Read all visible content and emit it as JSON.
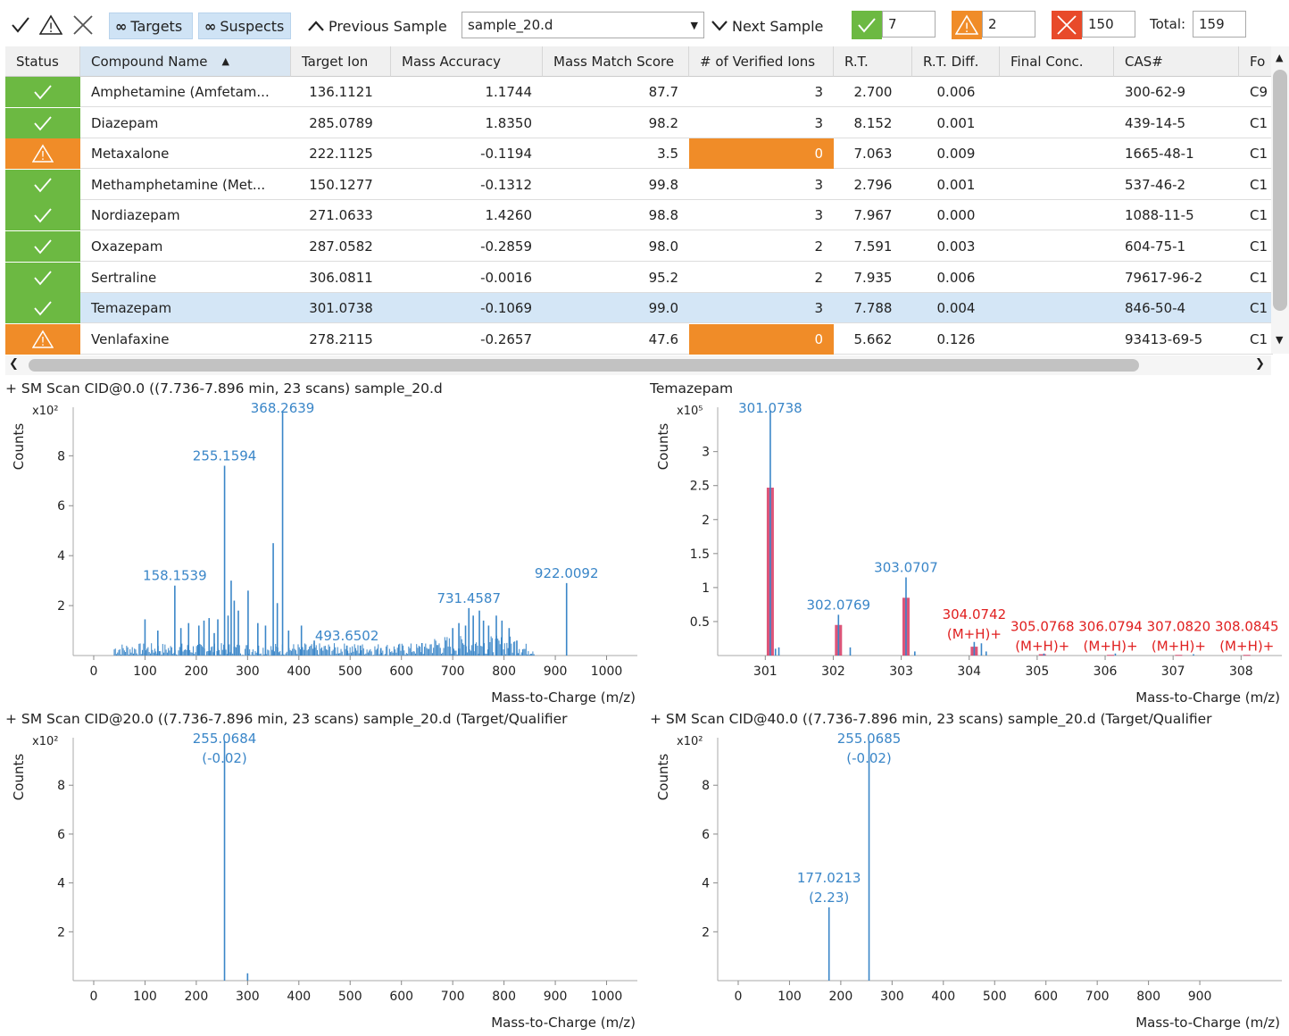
{
  "toolbar": {
    "targets_label": "Targets",
    "suspects_label": "Suspects",
    "previous_label": "Previous Sample",
    "sample_value": "sample_20.d",
    "next_label": "Next Sample",
    "count_ok": "7",
    "count_warn": "2",
    "count_fail": "150",
    "total_label": "Total:",
    "total_value": "159"
  },
  "table": {
    "columns": [
      "Status",
      "Compound Name",
      "Target Ion",
      "Mass Accuracy",
      "Mass Match Score",
      "# of Verified Ions",
      "R.T.",
      "R.T. Diff.",
      "Final Conc.",
      "CAS#",
      "Fo"
    ],
    "rows": [
      {
        "status": "ok",
        "name": "Amphetamine (Amfetam...",
        "ion": "136.1121",
        "acc": "1.1744",
        "score": "87.7",
        "verified": "3",
        "rt": "2.700",
        "rtdiff": "0.006",
        "conc": "",
        "cas": "300-62-9",
        "fo": "C9"
      },
      {
        "status": "ok",
        "name": "Diazepam",
        "ion": "285.0789",
        "acc": "1.8350",
        "score": "98.2",
        "verified": "3",
        "rt": "8.152",
        "rtdiff": "0.001",
        "conc": "",
        "cas": "439-14-5",
        "fo": "C1"
      },
      {
        "status": "warn",
        "name": "Metaxalone",
        "ion": "222.1125",
        "acc": "-0.1194",
        "score": "3.5",
        "verified": "0",
        "rt": "7.063",
        "rtdiff": "0.009",
        "conc": "",
        "cas": "1665-48-1",
        "fo": "C1"
      },
      {
        "status": "ok",
        "name": "Methamphetamine (Met...",
        "ion": "150.1277",
        "acc": "-0.1312",
        "score": "99.8",
        "verified": "3",
        "rt": "2.796",
        "rtdiff": "0.001",
        "conc": "",
        "cas": "537-46-2",
        "fo": "C1"
      },
      {
        "status": "ok",
        "name": "Nordiazepam",
        "ion": "271.0633",
        "acc": "1.4260",
        "score": "98.8",
        "verified": "3",
        "rt": "7.967",
        "rtdiff": "0.000",
        "conc": "",
        "cas": "1088-11-5",
        "fo": "C1"
      },
      {
        "status": "ok",
        "name": "Oxazepam",
        "ion": "287.0582",
        "acc": "-0.2859",
        "score": "98.0",
        "verified": "2",
        "rt": "7.591",
        "rtdiff": "0.003",
        "conc": "",
        "cas": "604-75-1",
        "fo": "C1"
      },
      {
        "status": "ok",
        "name": "Sertraline",
        "ion": "306.0811",
        "acc": "-0.0016",
        "score": "95.2",
        "verified": "2",
        "rt": "7.935",
        "rtdiff": "0.006",
        "conc": "",
        "cas": "79617-96-2",
        "fo": "C1"
      },
      {
        "status": "ok",
        "name": "Temazepam",
        "ion": "301.0738",
        "acc": "-0.1069",
        "score": "99.0",
        "verified": "3",
        "rt": "7.788",
        "rtdiff": "0.004",
        "conc": "",
        "cas": "846-50-4",
        "fo": "C1",
        "selected": true
      },
      {
        "status": "warn",
        "name": "Venlafaxine",
        "ion": "278.2115",
        "acc": "-0.2657",
        "score": "47.6",
        "verified": "0",
        "rt": "5.662",
        "rtdiff": "0.126",
        "conc": "",
        "cas": "93413-69-5",
        "fo": "C1"
      }
    ]
  },
  "colors": {
    "ok": "#6cb942",
    "warn": "#f08c28",
    "fail": "#e84a2a",
    "peak": "#3a86c8",
    "label_blue": "#3a86c8",
    "label_red": "#e02020",
    "iso_bar": "#d9426a"
  },
  "chart_data": [
    {
      "type": "bar",
      "title": "+ SM Scan  CID@0.0 ((7.736-7.896 min, 23 scans) sample_20.d",
      "xlabel": "Mass-to-Charge (m/z)",
      "ylabel": "Counts",
      "y_multiplier": "x10²",
      "xlim": [
        -40,
        1060
      ],
      "ylim": [
        0,
        9.8
      ],
      "xticks": [
        0,
        100,
        200,
        300,
        400,
        500,
        600,
        700,
        800,
        900,
        1000
      ],
      "yticks": [
        2,
        4,
        6,
        8
      ],
      "peaks": [
        {
          "x": 100,
          "y": 1.45
        },
        {
          "x": 125,
          "y": 1.0
        },
        {
          "x": 158.1539,
          "y": 2.8
        },
        {
          "x": 170,
          "y": 1.1
        },
        {
          "x": 185,
          "y": 1.3
        },
        {
          "x": 205,
          "y": 1.2
        },
        {
          "x": 215,
          "y": 1.4
        },
        {
          "x": 225,
          "y": 1.5
        },
        {
          "x": 235,
          "y": 0.9
        },
        {
          "x": 242,
          "y": 1.45
        },
        {
          "x": 255.1594,
          "y": 7.6
        },
        {
          "x": 262,
          "y": 1.6
        },
        {
          "x": 268,
          "y": 3.0
        },
        {
          "x": 274,
          "y": 2.2
        },
        {
          "x": 282,
          "y": 1.8
        },
        {
          "x": 301,
          "y": 2.6
        },
        {
          "x": 320,
          "y": 1.3
        },
        {
          "x": 335,
          "y": 1.2
        },
        {
          "x": 350,
          "y": 4.5
        },
        {
          "x": 358,
          "y": 2.1
        },
        {
          "x": 368.2639,
          "y": 9.8
        },
        {
          "x": 380,
          "y": 1.0
        },
        {
          "x": 405,
          "y": 1.2
        },
        {
          "x": 430,
          "y": 0.6
        },
        {
          "x": 493.6502,
          "y": 0.4
        },
        {
          "x": 520,
          "y": 0.4
        },
        {
          "x": 560,
          "y": 0.3
        },
        {
          "x": 640,
          "y": 0.5
        },
        {
          "x": 700,
          "y": 1.1
        },
        {
          "x": 712,
          "y": 1.3
        },
        {
          "x": 725,
          "y": 1.2
        },
        {
          "x": 731.4587,
          "y": 1.9
        },
        {
          "x": 740,
          "y": 1.6
        },
        {
          "x": 752,
          "y": 1.8
        },
        {
          "x": 760,
          "y": 1.4
        },
        {
          "x": 770,
          "y": 1.2
        },
        {
          "x": 785,
          "y": 1.6
        },
        {
          "x": 796,
          "y": 1.4
        },
        {
          "x": 810,
          "y": 1.1
        },
        {
          "x": 825,
          "y": 0.6
        },
        {
          "x": 922.0092,
          "y": 2.9
        }
      ],
      "noise": {
        "from": 40,
        "to": 860,
        "level": 0.5
      },
      "labels": [
        {
          "x": 158.1539,
          "y": 2.8,
          "text": "158.1539"
        },
        {
          "x": 255.1594,
          "y": 7.6,
          "text": "255.1594"
        },
        {
          "x": 368.2639,
          "y": 9.8,
          "text": "368.2639"
        },
        {
          "x": 493.6502,
          "y": 0.4,
          "text": "493.6502"
        },
        {
          "x": 731.4587,
          "y": 1.9,
          "text": "731.4587"
        },
        {
          "x": 922.0092,
          "y": 2.9,
          "text": "922.0092"
        }
      ]
    },
    {
      "type": "bar",
      "title": "Temazepam",
      "xlabel": "Mass-to-Charge (m/z)",
      "ylabel": "Counts",
      "y_multiplier": "x10⁵",
      "xlim": [
        300.3,
        308.6
      ],
      "ylim": [
        0,
        3.6
      ],
      "xticks": [
        301,
        302,
        303,
        304,
        305,
        306,
        307,
        308
      ],
      "yticks": [
        0.5,
        1,
        1.5,
        2,
        2.5,
        3
      ],
      "peaks": [
        {
          "x": 301.0738,
          "y": 3.6
        },
        {
          "x": 301.15,
          "y": 0.1
        },
        {
          "x": 301.2,
          "y": 0.12
        },
        {
          "x": 302.0769,
          "y": 0.6
        },
        {
          "x": 302.25,
          "y": 0.12
        },
        {
          "x": 303.0707,
          "y": 1.15
        },
        {
          "x": 303.2,
          "y": 0.06
        },
        {
          "x": 304.0742,
          "y": 0.2
        },
        {
          "x": 304.18,
          "y": 0.18
        },
        {
          "x": 304.25,
          "y": 0.06
        },
        {
          "x": 305.1,
          "y": 0.03
        },
        {
          "x": 306.15,
          "y": 0.03
        },
        {
          "x": 307.3,
          "y": 0.02
        }
      ],
      "iso_bars": [
        {
          "x": 301.0738,
          "y": 2.47
        },
        {
          "x": 302.0769,
          "y": 0.45
        },
        {
          "x": 303.0707,
          "y": 0.85
        },
        {
          "x": 304.0742,
          "y": 0.13
        },
        {
          "x": 305.0768,
          "y": 0.02
        },
        {
          "x": 306.0794,
          "y": 0.01
        },
        {
          "x": 307.082,
          "y": 0.01
        },
        {
          "x": 308.0845,
          "y": 0.01
        }
      ],
      "labels": [
        {
          "x": 301.0738,
          "y": 3.6,
          "text": "301.0738",
          "color": "blue"
        },
        {
          "x": 302.0769,
          "y": 0.6,
          "text": "302.0769",
          "color": "blue"
        },
        {
          "x": 303.0707,
          "y": 1.15,
          "text": "303.0707",
          "color": "blue"
        },
        {
          "x": 304.0742,
          "y": 0.2,
          "text": "304.0742",
          "sub": "(M+H)+",
          "color": "red"
        },
        {
          "x": 305.0768,
          "y": 0.02,
          "text": "305.0768",
          "sub": "(M+H)+",
          "color": "red"
        },
        {
          "x": 306.0794,
          "y": 0.02,
          "text": "306.0794",
          "sub": "(M+H)+",
          "color": "red"
        },
        {
          "x": 307.082,
          "y": 0.02,
          "text": "307.0820",
          "sub": "(M+H)+",
          "color": "red"
        },
        {
          "x": 308.0845,
          "y": 0.02,
          "text": "308.0845",
          "sub": "(M+H)+",
          "color": "red"
        }
      ]
    },
    {
      "type": "bar",
      "title": "+ SM Scan  CID@20.0 ((7.736-7.896 min, 23 scans) sample_20.d (Target/Qualifier",
      "xlabel": "Mass-to-Charge (m/z)",
      "ylabel": "Counts",
      "y_multiplier": "x10²",
      "xlim": [
        -40,
        1060
      ],
      "ylim": [
        0,
        9.8
      ],
      "xticks": [
        0,
        100,
        200,
        300,
        400,
        500,
        600,
        700,
        800,
        900,
        1000
      ],
      "yticks": [
        2,
        4,
        6,
        8
      ],
      "peaks": [
        {
          "x": 255.0684,
          "y": 9.8
        },
        {
          "x": 300,
          "y": 0.3
        }
      ],
      "labels": [
        {
          "x": 255.0684,
          "y": 9.8,
          "text": "255.0684",
          "sub": "(-0.02)"
        }
      ]
    },
    {
      "type": "bar",
      "title": "+ SM Scan  CID@40.0 ((7.736-7.896 min, 23 scans) sample_20.d (Target/Qualifier",
      "xlabel": "Mass-to-Charge (m/z)",
      "ylabel": "Counts",
      "y_multiplier": "x10²",
      "xlim": [
        -40,
        1060
      ],
      "ylim": [
        0,
        9.8
      ],
      "xticks": [
        0,
        100,
        200,
        300,
        400,
        500,
        600,
        700,
        800,
        900
      ],
      "yticks": [
        2,
        4,
        6,
        8
      ],
      "peaks": [
        {
          "x": 177.0213,
          "y": 3.0
        },
        {
          "x": 255.0685,
          "y": 9.8
        }
      ],
      "labels": [
        {
          "x": 177.0213,
          "y": 3.0,
          "text": "177.0213",
          "sub": "(2.23)"
        },
        {
          "x": 255.0685,
          "y": 9.8,
          "text": "255.0685",
          "sub": "(-0.02)"
        }
      ]
    }
  ]
}
